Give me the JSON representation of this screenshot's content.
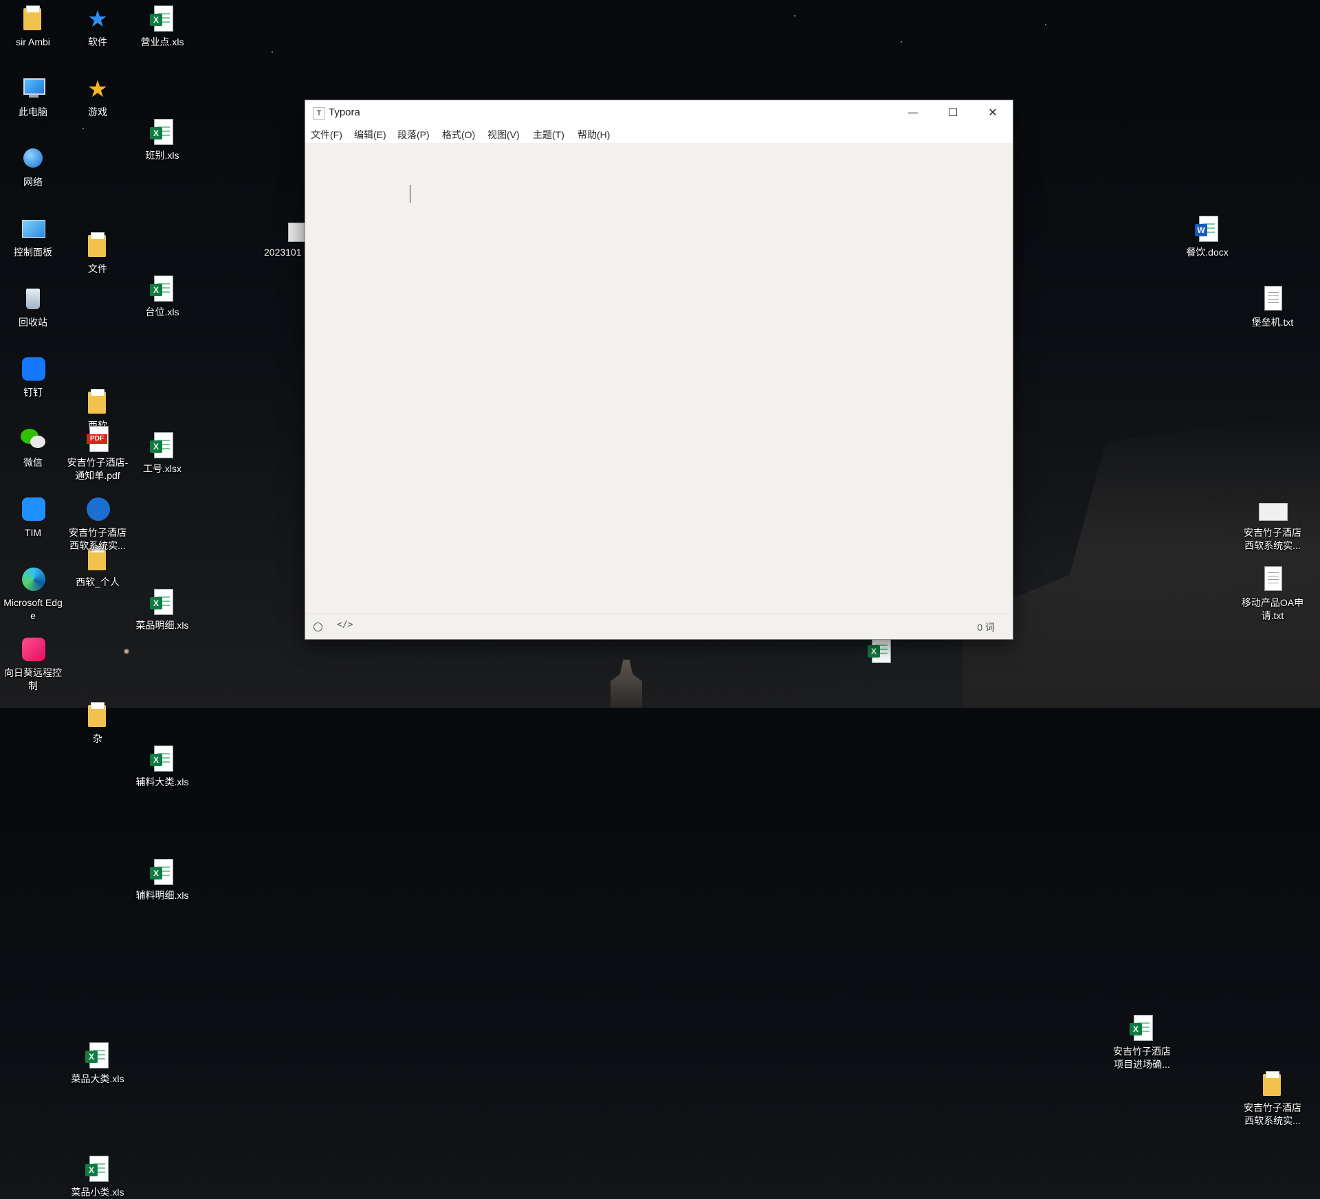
{
  "desktop": {
    "icons": [
      {
        "label": "sir Ambi"
      },
      {
        "label": "软件"
      },
      {
        "label": "营业点.xls"
      },
      {
        "label": "此电脑"
      },
      {
        "label": "游戏"
      },
      {
        "label": "班别.xls"
      },
      {
        "label": "网络"
      },
      {
        "label": "文件"
      },
      {
        "label": "台位.xls"
      },
      {
        "label": "控制面板"
      },
      {
        "label": "西软"
      },
      {
        "label": "工号.xlsx"
      },
      {
        "label": "回收站"
      },
      {
        "label": "西软_个人"
      },
      {
        "label": "菜品明细.xls"
      },
      {
        "label": "钉钉"
      },
      {
        "label": "杂"
      },
      {
        "label": "辅料大类.xls"
      },
      {
        "label": "微信"
      },
      {
        "label": "安吉竹子酒店-通知单.pdf"
      },
      {
        "label": "辅料明细.xls"
      },
      {
        "label": "TIM"
      },
      {
        "label": "安吉竹子酒店西软系统实..."
      },
      {
        "label": "Microsoft Edge"
      },
      {
        "label": "菜品大类.xls"
      },
      {
        "label": "向日葵远程控制"
      },
      {
        "label": "菜品小类.xls"
      },
      {
        "label": "2023101"
      },
      {
        "label": "餐饮.docx"
      },
      {
        "label": "堡垒机.txt"
      },
      {
        "label": "安吉竹子酒店项目进场确..."
      },
      {
        "label": "安吉竹子酒店西软系统实..."
      },
      {
        "label": "安吉竹子酒店西软系统实..."
      },
      {
        "label": "移动产品OA申请.txt"
      }
    ]
  },
  "window": {
    "title": "Typora",
    "app_glyph": "T",
    "minimize": "—",
    "maximize": "☐",
    "close": "✕",
    "menu": [
      "文件(F)",
      "编辑(E)",
      "段落(P)",
      "格式(O)",
      "视图(V)",
      "主题(T)",
      "帮助(H)"
    ],
    "status": {
      "code_glyph": "</>",
      "word_count": "0 词"
    }
  }
}
